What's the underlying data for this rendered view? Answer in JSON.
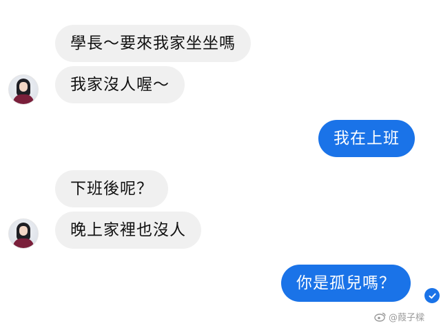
{
  "colors": {
    "incoming_bubble": "#f0f0f0",
    "outgoing_bubble": "#1a73e8",
    "incoming_text": "#111111",
    "outgoing_text": "#ffffff"
  },
  "messages": [
    {
      "direction": "incoming",
      "text": "學長～要來我家坐坐嗎"
    },
    {
      "direction": "incoming",
      "text": "我家沒人喔～"
    },
    {
      "direction": "outgoing",
      "text": "我在上班"
    },
    {
      "direction": "incoming",
      "text": "下班後呢？"
    },
    {
      "direction": "incoming",
      "text": "晚上家裡也沒人"
    },
    {
      "direction": "outgoing",
      "text": "你是孤兒嗎？"
    }
  ],
  "status": {
    "icon": "seen-check-icon"
  },
  "watermark": {
    "icon": "weibo-logo-icon",
    "text": "@葭子樑"
  }
}
